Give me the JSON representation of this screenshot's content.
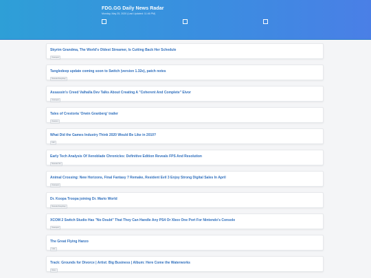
{
  "header": {
    "title": "FDG.GG Daily News Radar",
    "subtitle": "Monday, May 25, 2020 (Last Updated: 11:46 PM)"
  },
  "stories": [
    {
      "headline": "Skyrim Grandma, The World's Oldest Streamer, Is Cutting Back Her Schedule",
      "source": "Gamespot"
    },
    {
      "headline": "Tangledeep update coming soon to Switch (version 1.32e), patch notes",
      "source": "Nintendo Everything"
    },
    {
      "headline": "Assassin's Creed Valhalla Dev Talks About Creating A \"Coherent And Complete\" Eivor",
      "source": "Gamespot"
    },
    {
      "headline": "Tales of Crestoria 'Orwin Granberg' trailer",
      "source": "Gematsu"
    },
    {
      "headline": "What Did the Games Industry Think 2020 Would Be Like in 2010?",
      "source": "IGN"
    },
    {
      "headline": "Early Tech Analysis Of Xenoblade Chronicles: Definitive Edition Reveals FPS And Resolution",
      "source": "Nintendo Life"
    },
    {
      "headline": "Animal Crossing: New Horizons, Final Fantasy 7 Remake, Resident Evil 3 Enjoy Strong Digital Sales In April",
      "source": "Gamespot"
    },
    {
      "headline": "Dr. Koopa Troopa joining Dr. Mario World",
      "source": "Nintendo Everything"
    },
    {
      "headline": "XCOM 2 Switch Studio Has \"No Doubt\" That They Can Handle Any PS4 Or Xbox One Port For Nintendo's Console",
      "source": "Gamespot"
    },
    {
      "headline": "The Great Flying Hanzo",
      "source": "Indie"
    },
    {
      "headline": "Track: Grounds for Divorce | Artist: Big Business | Album: Here Come the Waterworks",
      "source": "Music"
    }
  ]
}
